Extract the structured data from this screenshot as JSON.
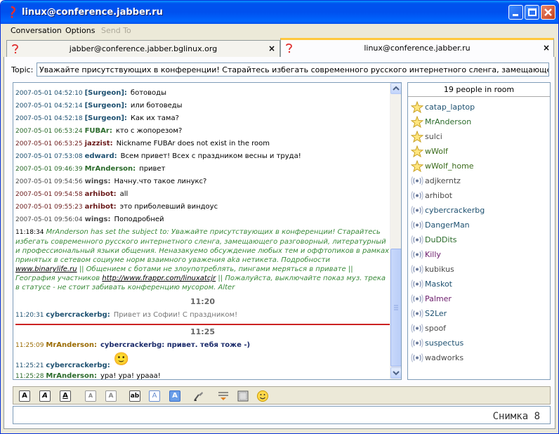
{
  "window": {
    "title": "linux@conference.jabber.ru"
  },
  "menu": {
    "items": [
      "Conversation",
      "Options",
      "Send To"
    ]
  },
  "tabs": [
    {
      "label": "jabber@conference.jabber.bglinux.org",
      "close": "×"
    },
    {
      "label": "linux@conference.jabber.ru",
      "close": "×"
    }
  ],
  "topic": {
    "label": "Topic:",
    "value": "Уважайте присутствующих в конференции! Старайтесь избегать современного русского интернетного сленга, замещающего разговорный,"
  },
  "chat": {
    "messages": [
      {
        "ts": "2007-05-01 04:52:10",
        "nick": "[Surgeon]:",
        "text": "ботоводы",
        "nick_color": "#1d5070"
      },
      {
        "ts": "2007-05-01 04:52:14",
        "nick": "[Surgeon]:",
        "text": "или ботоведы",
        "nick_color": "#1d5070"
      },
      {
        "ts": "2007-05-01 04:52:18",
        "nick": "[Surgeon]:",
        "text": "Как их тама?",
        "nick_color": "#1d5070"
      },
      {
        "ts": "2007-05-01 06:53:24",
        "nick": "FUBAr:",
        "text": "кто с жопорезом?",
        "nick_color": "#2a6a2a"
      },
      {
        "ts": "2007-05-01 06:53:25",
        "nick": "jazzist:",
        "text": "Nickname FUBAr does not exist in the room",
        "nick_color": "#6a1a1a"
      },
      {
        "ts": "2007-05-01 07:53:08",
        "nick": "edward:",
        "text": "Всем привет! Всех с праздником весны и труда!",
        "nick_color": "#1d5070"
      },
      {
        "ts": "2007-05-01 09:46:39",
        "nick": "MrAnderson:",
        "text": "привет",
        "nick_color": "#2a6a2a"
      },
      {
        "ts": "2007-05-01 09:54:56",
        "nick": "wings:",
        "text": "Начну.что такое линукс?",
        "nick_color": "#4a4a4a"
      },
      {
        "ts": "2007-05-01 09:54:58",
        "nick": "arhibot:",
        "text": "all",
        "nick_color": "#6a1a1a"
      },
      {
        "ts": "2007-05-01 09:55:23",
        "nick": "arhibot:",
        "text": "это приболевший виндоус",
        "nick_color": "#6a1a1a"
      },
      {
        "ts": "2007-05-01 09:56:04",
        "nick": "wings:",
        "text": "Поподробней",
        "nick_color": "#4a4a4a"
      }
    ],
    "subject": {
      "ts": "11:18:34",
      "text_1": "MrAnderson has set the subject to: Уважайте присутствующих в конференции! Старайтесь избегать современного русского интернетного сленга, замещающего разговорный, литературный и профессиональный языки общения. Неназакуемо обсуждение любых тем и оффтопиков в рамках принятых в сетевом социуме норм взаимного уважения aka нетикета. Подробности",
      "link_1": "www.binarylife.ru",
      "text_2": "|| Общением с ботами не злоупотреблять, пингами меряться в привате || География участников",
      "link_2": "http://www.frappr.com/linuxatcjr",
      "text_3": "|| Пожалуйста, выключайте показ муз. трека в статусе - не стоит забивать конференцию мусором. Alter"
    },
    "sep_1": "11:20",
    "msg_1120": {
      "ts": "11:20:31",
      "nick": "cybercrackerbg:",
      "text": "Привет из Софии! С праздником!"
    },
    "sep_2": "11:25",
    "msg_1125a": {
      "ts": "11:25:09",
      "nick": "MrAnderson:",
      "text": "cybercrackerbg: привет. тебя тоже -)"
    },
    "msg_1125b": {
      "ts": "11:25:21",
      "nick": "cybercrackerbg:",
      "text": "🙂"
    },
    "msg_1125c": {
      "ts": "11:25:28",
      "nick": "MrAnderson:",
      "text": "ура! ура! урааа!"
    }
  },
  "roster": {
    "header": "19 people in room",
    "members": [
      {
        "name": "catap_laptop",
        "role": "moderator",
        "color": "#1d5070"
      },
      {
        "name": "MrAnderson",
        "role": "moderator",
        "color": "#2a6a2a"
      },
      {
        "name": "sulci",
        "role": "moderator",
        "color": "#4a4a4a"
      },
      {
        "name": "wWolf",
        "role": "moderator",
        "color": "#3a6a1a"
      },
      {
        "name": "wWolf_home",
        "role": "moderator",
        "color": "#3a6a1a"
      },
      {
        "name": "adjkerntz",
        "role": "participant",
        "color": "#4a4a4a"
      },
      {
        "name": "arhibot",
        "role": "participant",
        "color": "#4a4a4a"
      },
      {
        "name": "cybercrackerbg",
        "role": "participant",
        "color": "#1d5070"
      },
      {
        "name": "DangerMan",
        "role": "participant",
        "color": "#1d5070"
      },
      {
        "name": "DuDDits",
        "role": "participant",
        "color": "#2a6a2a"
      },
      {
        "name": "Killy",
        "role": "participant",
        "color": "#6a1a6a"
      },
      {
        "name": "kubikus",
        "role": "participant",
        "color": "#4a4a4a"
      },
      {
        "name": "Maskot",
        "role": "participant",
        "color": "#1d5070"
      },
      {
        "name": "Palmer",
        "role": "participant",
        "color": "#6a1a6a"
      },
      {
        "name": "S2Ler",
        "role": "participant",
        "color": "#1d5070"
      },
      {
        "name": "spoof",
        "role": "participant",
        "color": "#4a4a4a"
      },
      {
        "name": "suspectus",
        "role": "participant",
        "color": "#1d5070"
      },
      {
        "name": "wadworks",
        "role": "participant",
        "color": "#4a4a4a"
      }
    ]
  },
  "format_bar": {
    "buttons": [
      {
        "name": "bold-button",
        "glyph": "A"
      },
      {
        "name": "italic-button",
        "glyph": "A"
      },
      {
        "name": "underline-button",
        "glyph": "A"
      },
      {
        "name": "decrease-font-button",
        "glyph": "A"
      },
      {
        "name": "increase-font-button",
        "glyph": "A"
      },
      {
        "name": "font-face-button",
        "glyph": "ab"
      },
      {
        "name": "foreground-color-button",
        "glyph": "A"
      },
      {
        "name": "background-color-button",
        "glyph": "A"
      }
    ]
  },
  "caption": "Снимка  8"
}
